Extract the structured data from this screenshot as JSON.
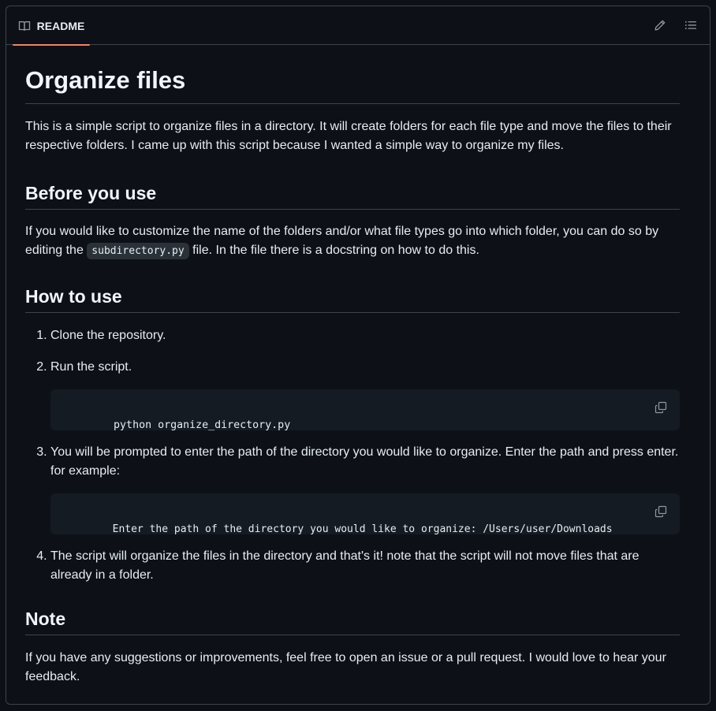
{
  "header": {
    "tab_label": "README",
    "edit_icon": "pencil-icon",
    "outline_icon": "list-unordered-icon",
    "accent_color": "#f78166"
  },
  "readme": {
    "title": "Organize files",
    "intro": "This is a simple script to organize files in a directory. It will create folders for each file type and move the files to their respective folders. I came up with this script because I wanted a simple way to organize my files.",
    "before_heading": "Before you use",
    "before_text_1": "If you would like to customize the name of the folders and/or what file types go into which folder, you can do so by editing the",
    "before_code": "subdirectory.py",
    "before_text_2": "file. In the file there is a docstring on how to do this.",
    "howto_heading": "How to use",
    "steps": [
      {
        "text": "Clone the repository."
      },
      {
        "text": "Run the script.",
        "code": "python organize_directory.py"
      },
      {
        "text": "You will be prompted to enter the path of the directory you would like to organize. Enter the path and press enter. for example:",
        "code": "Enter the path of the directory you would like to organize: /Users/user/Downloads"
      },
      {
        "text": "The script will organize the files in the directory and that's it! note that the script will not move files that are already in a folder."
      }
    ],
    "note_heading": "Note",
    "note_text": "If you have any suggestions or improvements, feel free to open an issue or a pull request. I would love to hear your feedback."
  }
}
